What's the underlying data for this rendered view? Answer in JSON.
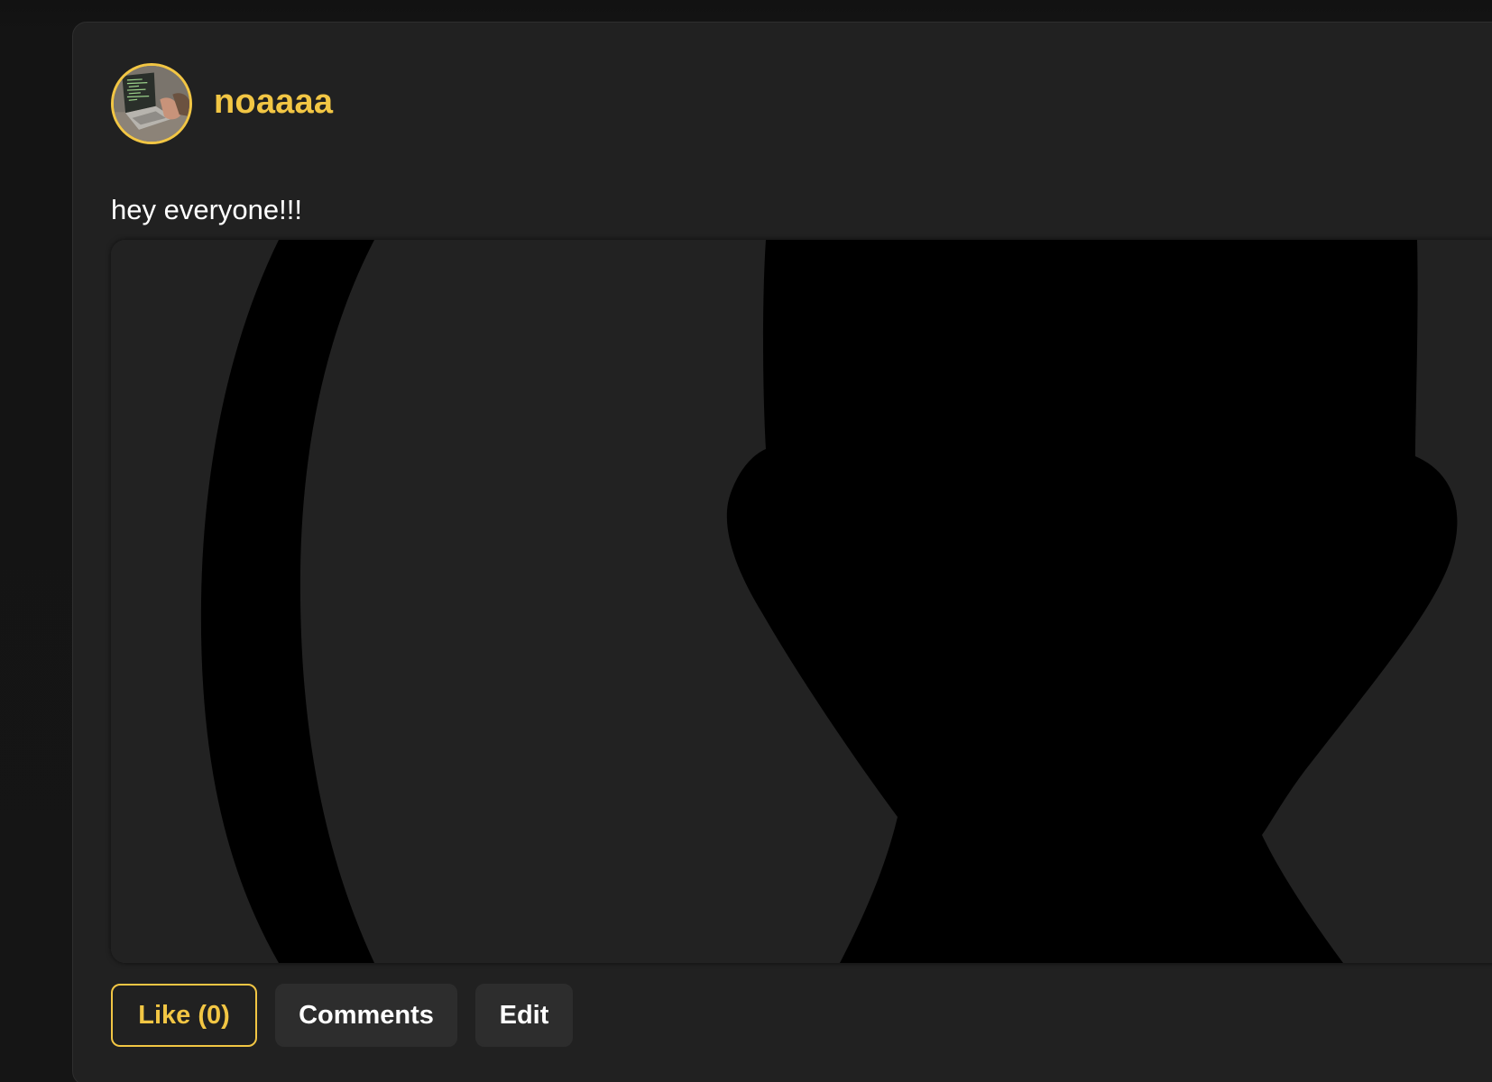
{
  "post": {
    "author": "noaaaa",
    "text": "hey everyone!!!",
    "avatar_icon": "user-avatar-photo-laptop",
    "media_icon": "default-profile-silhouette-icon"
  },
  "actions": {
    "like_label": "Like (0)",
    "comments_label": "Comments",
    "edit_label": "Edit"
  },
  "colors": {
    "accent": "#f2c644",
    "card_bg": "#212121",
    "button_bg": "#2d2d2d",
    "page_bg": "#141414"
  }
}
